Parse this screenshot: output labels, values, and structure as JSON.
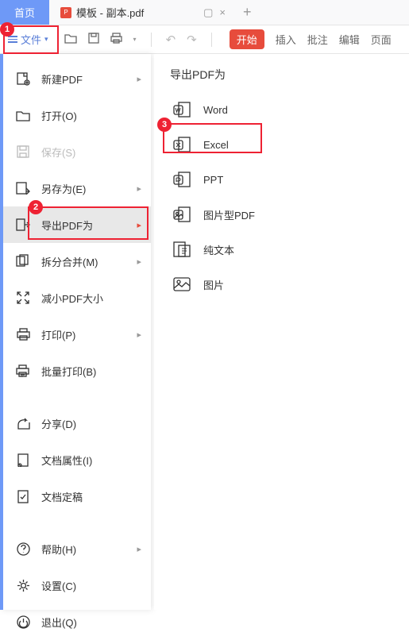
{
  "tabs": {
    "home": "首页",
    "file_name": "模板 - 副本.pdf",
    "pdf_badge": "P"
  },
  "toolbar": {
    "file_button": "文件",
    "menu": {
      "start": "开始",
      "insert": "插入",
      "annotate": "批注",
      "edit": "编辑",
      "page": "页面"
    }
  },
  "file_menu": {
    "items": [
      {
        "label": "新建PDF",
        "arrow": true
      },
      {
        "label": "打开(O)"
      },
      {
        "label": "保存(S)",
        "disabled": true
      },
      {
        "label": "另存为(E)",
        "arrow": true
      },
      {
        "label": "导出PDF为",
        "arrow": true,
        "selected": true
      },
      {
        "label": "拆分合并(M)",
        "arrow": true
      },
      {
        "label": "减小PDF大小"
      },
      {
        "label": "打印(P)",
        "arrow": true
      },
      {
        "label": "批量打印(B)"
      },
      {
        "label": "分享(D)"
      },
      {
        "label": "文档属性(I)"
      },
      {
        "label": "文档定稿"
      },
      {
        "label": "帮助(H)",
        "arrow": true
      },
      {
        "label": "设置(C)"
      },
      {
        "label": "退出(Q)"
      }
    ]
  },
  "submenu": {
    "title": "导出PDF为",
    "items": [
      {
        "label": "Word"
      },
      {
        "label": "Excel"
      },
      {
        "label": "PPT"
      },
      {
        "label": "图片型PDF"
      },
      {
        "label": "纯文本"
      },
      {
        "label": "图片"
      }
    ]
  },
  "annotations": {
    "a1": "1",
    "a2": "2",
    "a3": "3"
  }
}
